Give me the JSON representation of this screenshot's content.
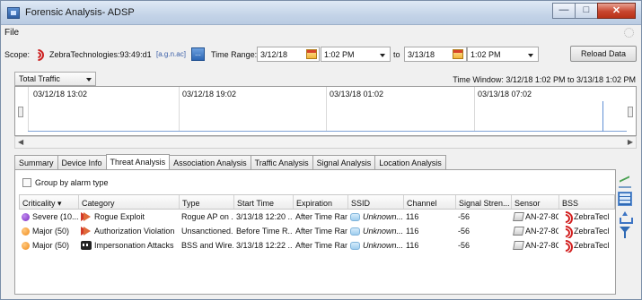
{
  "window": {
    "title": "Forensic Analysis- ADSP"
  },
  "menu": {
    "file": "File"
  },
  "toolbar": {
    "scope_label": "Scope:",
    "scope_value": "ZebraTechnologies:93:49:d1",
    "scope_suffix": "[a.g.n.ac]",
    "time_range_label": "Time Range:",
    "start_date": "3/12/18",
    "start_time": "1:02 PM",
    "to_label": "to",
    "end_date": "3/13/18",
    "end_time": "1:02 PM",
    "reload_button": "Reload Data"
  },
  "filter": {
    "traffic_combo": "Total Traffic",
    "time_window": "Time Window: 3/12/18 1:02 PM to 3/13/18 1:02 PM"
  },
  "timeline": {
    "labels": [
      "03/12/18 13:02",
      "03/12/18 19:02",
      "03/13/18 01:02",
      "03/13/18 07:02"
    ]
  },
  "tabs": [
    "Summary",
    "Device Info",
    "Threat Analysis",
    "Association Analysis",
    "Traffic Analysis",
    "Signal Analysis",
    "Location Analysis"
  ],
  "active_tab": "Threat Analysis",
  "threat_panel": {
    "group_by_label": "Group by alarm type",
    "columns": [
      "Criticality ▾",
      "Category",
      "Type",
      "Start Time",
      "Expiration",
      "SSID",
      "Channel",
      "Signal Stren...",
      "Sensor",
      "BSS"
    ],
    "rows": [
      {
        "criticality": "Severe (10...",
        "criticality_color": "#7b2bbf",
        "category": "Rogue Exploit",
        "category_icon": "rogue-arrow-icon",
        "type": "Rogue AP on ...",
        "start_time": "3/13/18 12:20 ...",
        "expiration": "After Time Ran...",
        "ssid": "Unknown...",
        "channel": "116",
        "signal": "-56",
        "sensor": "AN-27-8C",
        "bss": "ZebraTecl"
      },
      {
        "criticality": "Major (50)",
        "criticality_color": "#f08a18",
        "category": "Authorization Violation",
        "category_icon": "auth-arrow-icon",
        "type": "Unsanctioned...",
        "start_time": "Before Time R...",
        "expiration": "After Time Ran...",
        "ssid": "Unknown...",
        "channel": "116",
        "signal": "-56",
        "sensor": "AN-27-8C",
        "bss": "ZebraTecl"
      },
      {
        "criticality": "Major (50)",
        "criticality_color": "#f08a18",
        "category": "Impersonation Attacks",
        "category_icon": "mask-icon",
        "type": "BSS and Wire...",
        "start_time": "3/13/18 12:22 ...",
        "expiration": "After Time Ran...",
        "ssid": "Unknown...",
        "channel": "116",
        "signal": "-56",
        "sensor": "AN-27-8C",
        "bss": "ZebraTecl"
      }
    ]
  }
}
